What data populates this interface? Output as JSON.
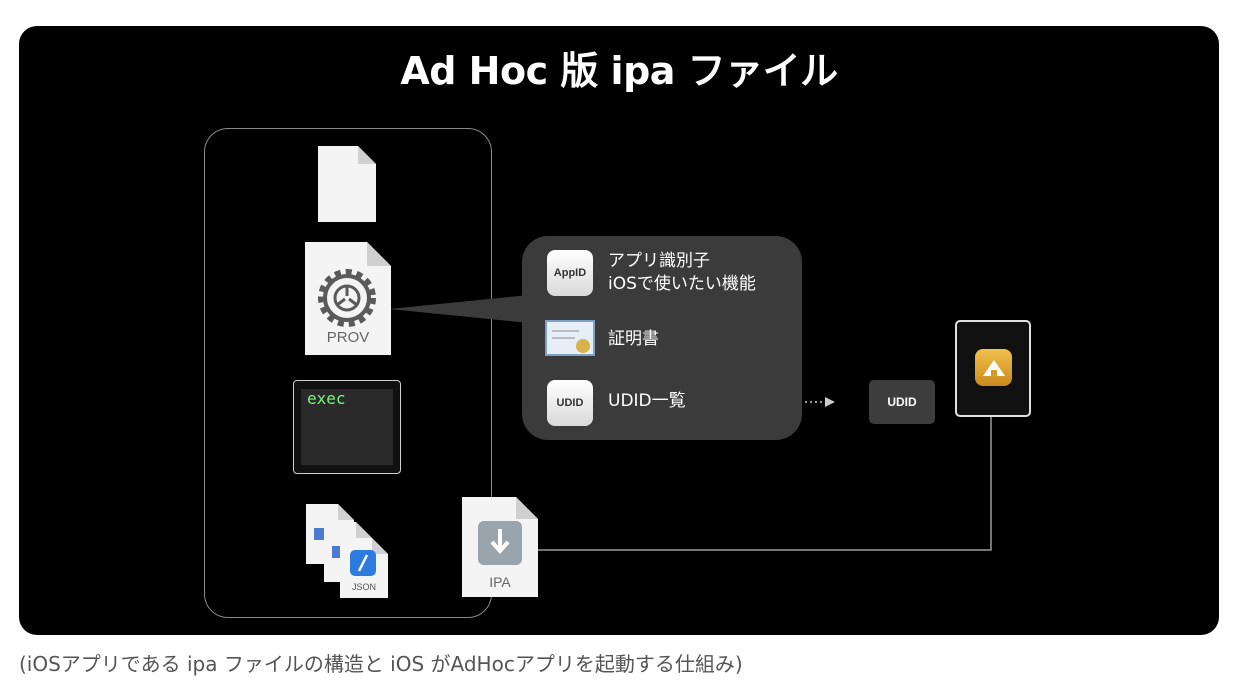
{
  "slide": {
    "title": "Ad Hoc 版 ipa ファイル"
  },
  "files": {
    "prov_label": "PROV",
    "exec_label": "exec",
    "json_label": "JSON",
    "ipa_label": "IPA"
  },
  "bubble": {
    "appid_icon": "AppID",
    "appid_line1": "アプリ識別子",
    "appid_line2": "iOSで使いたい機能",
    "cert_icon": "certificate-icon",
    "cert_text": "証明書",
    "udid_icon": "UDID",
    "udid_text": "UDID一覧"
  },
  "device": {
    "udid_label": "UDID",
    "app_icon": "app-icon"
  },
  "caption": "(iOSアプリである ipa ファイルの構造と iOS がAdHocアプリを起動する仕組み)",
  "colors": {
    "background": "#000000",
    "bubble": "#3b3b3b",
    "exec_text": "#7cf27c",
    "app_icon": "#e8ad33"
  }
}
